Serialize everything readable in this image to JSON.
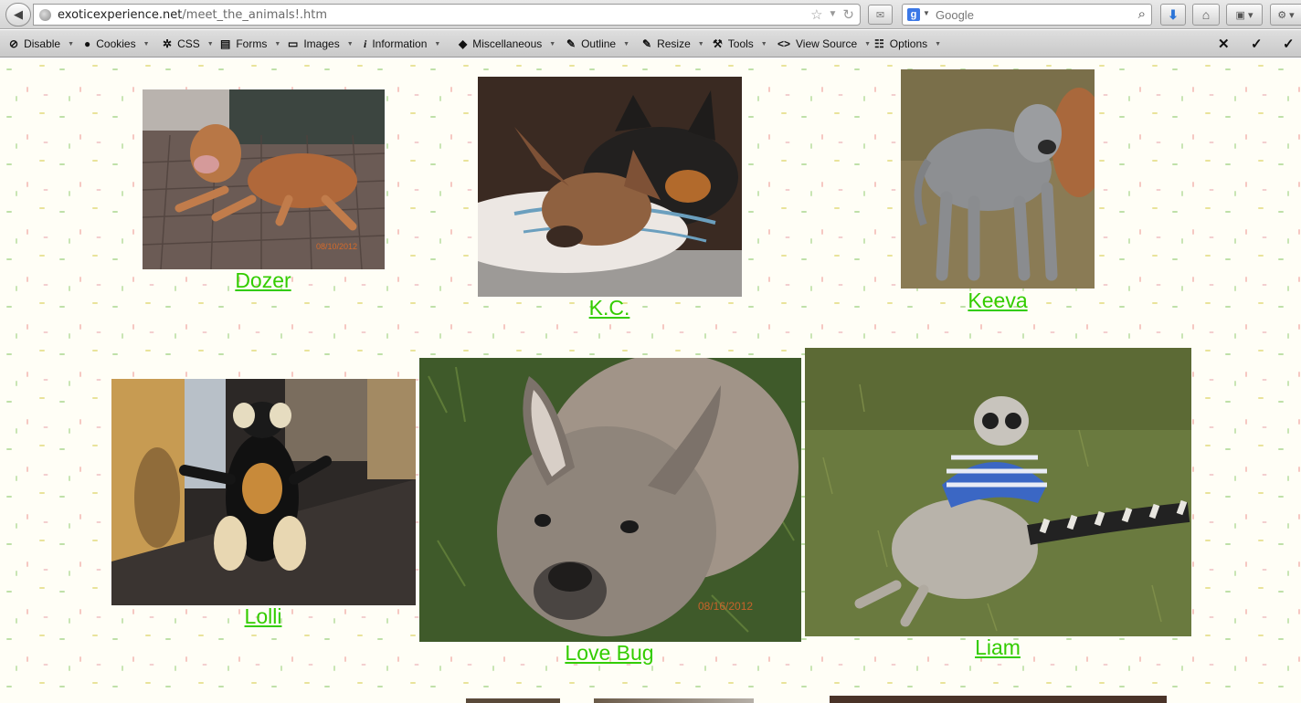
{
  "browser": {
    "url_domain": "exoticexperience.net",
    "url_path": "/meet_the_animals!.htm",
    "search_engine": "Google",
    "search_placeholder": "Google"
  },
  "devtoolbar": {
    "items": [
      {
        "label": "Disable",
        "icon": "disable-icon"
      },
      {
        "label": "Cookies",
        "icon": "cookies-icon"
      },
      {
        "label": "CSS",
        "icon": "css-icon"
      },
      {
        "label": "Forms",
        "icon": "forms-icon"
      },
      {
        "label": "Images",
        "icon": "images-icon"
      },
      {
        "label": "Information",
        "icon": "information-icon"
      },
      {
        "label": "Miscellaneous",
        "icon": "miscellaneous-icon"
      },
      {
        "label": "Outline",
        "icon": "outline-icon"
      },
      {
        "label": "Resize",
        "icon": "resize-icon"
      },
      {
        "label": "Tools",
        "icon": "tools-icon"
      },
      {
        "label": "View Source",
        "icon": "view-source-icon"
      },
      {
        "label": "Options",
        "icon": "options-icon"
      }
    ]
  },
  "animals": [
    {
      "name": "Dozer",
      "photo_date": "08/10/2012"
    },
    {
      "name": "K.C."
    },
    {
      "name": "Keeva"
    },
    {
      "name": "Lolli"
    },
    {
      "name": "Love Bug",
      "photo_date": "08/16/2012"
    },
    {
      "name": "Liam"
    }
  ],
  "colors": {
    "link": "#33cc00"
  }
}
